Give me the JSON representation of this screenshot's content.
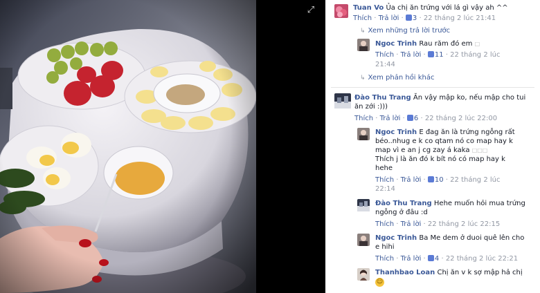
{
  "comments": [
    {
      "author": "Tuan Vo",
      "text": "Ủa chị ăn trứng với lá gì vậy ah ^^",
      "like": "Thích",
      "reply": "Trả lời",
      "likes": "3",
      "time": "22 tháng 2 lúc 21:41"
    },
    {
      "author": "Ngoc Trinh",
      "text": "Rau răm đó em",
      "like": "Thích",
      "reply": "Trả lời",
      "likes": "11",
      "time1": "22 tháng 2 lúc",
      "time2": "21:44"
    },
    {
      "author": "Đào Thu Trang",
      "text1": "Ăn vậy mập ko, nếu mập cho tui",
      "text2": "ăn zới :)))",
      "like": "Thích",
      "reply": "Trả lời",
      "likes": "6",
      "time": "22 tháng 2 lúc 22:00"
    },
    {
      "author": "Ngoc Trinh",
      "text1": "E đag ăn là trứng ngỗng rất",
      "text2": "béo..nhug e k co qtam nó co map hay k",
      "text3": "map vì e an j cg zay á kaka",
      "text4": "Thích j là ăn đó k bít nó có map hay k",
      "text5": "hehe",
      "like": "Thích",
      "reply": "Trả lời",
      "likes": "10",
      "time1": "22 tháng 2 lúc",
      "time2": "22:14"
    },
    {
      "author": "Đào Thu Trang",
      "text1": "Hehe muốn hỏi mua trứng",
      "text2": "ngỗng ở đâu :d",
      "like": "Thích",
      "reply": "Trả lời",
      "time": "22 tháng 2 lúc 22:15"
    },
    {
      "author": "Ngoc Trinh",
      "text1": "Ba Me dem ở duoi quê lên cho",
      "text2": "e hihi",
      "like": "Thích",
      "reply": "Trả lời",
      "likes": "4",
      "time": "22 tháng 2 lúc 22:21"
    },
    {
      "author": "Thanhbao Loan",
      "text": "Chị ăn v k sợ mập hả chị"
    }
  ],
  "links": {
    "previous_replies": "Xem những trả lời trước",
    "other_replies": "Xem phản hồi khác"
  },
  "colors": {
    "link": "#3b5998",
    "meta": "#9197a3",
    "photo_bg": "#000000"
  }
}
